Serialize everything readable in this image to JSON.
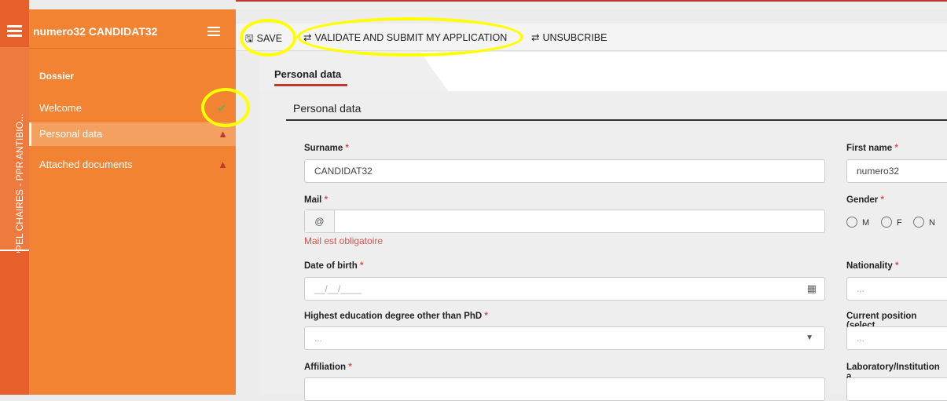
{
  "rail": {
    "vertical_label": "APPEL CHAIRES - PPR ANTIBIO..."
  },
  "sidebar": {
    "title": "numero32 CANDIDAT32",
    "section": "Dossier",
    "items": [
      {
        "label": "Welcome",
        "status": "check-icon"
      },
      {
        "label": "Personal data",
        "status": "warning-icon"
      },
      {
        "label": "Attached documents",
        "status": "warning-icon"
      }
    ]
  },
  "toolbar": {
    "save_label": "SAVE",
    "validate_label": "VALIDATE AND SUBMIT MY APPLICATION",
    "unsubscribe_label": "UNSUBCRIBE"
  },
  "tab": {
    "label": "Personal data"
  },
  "panel": {
    "title": "Personal data"
  },
  "form": {
    "surname": {
      "label": "Surname",
      "value": "CANDIDAT32"
    },
    "first_name": {
      "label": "First name",
      "value": "numero32"
    },
    "mail": {
      "label": "Mail",
      "value": "",
      "addon": "@",
      "error": "Mail est obligatoire"
    },
    "gender": {
      "label": "Gender",
      "options": [
        "M",
        "F",
        "N"
      ]
    },
    "dob": {
      "label": "Date of birth",
      "placeholder": "__/__/____"
    },
    "nationality": {
      "label": "Nationality",
      "placeholder": "..."
    },
    "education": {
      "label": "Highest education degree other than PhD",
      "placeholder": "..."
    },
    "position": {
      "label": "Current position (select",
      "placeholder": "..."
    },
    "affiliation": {
      "label": "Affiliation"
    },
    "lab": {
      "label": "Laboratory/Institution a"
    }
  },
  "colors": {
    "accent": "#f18332",
    "rail": "#e5602a",
    "error": "#d9534f",
    "check": "#6ab04c",
    "highlight": "#ffff00"
  }
}
